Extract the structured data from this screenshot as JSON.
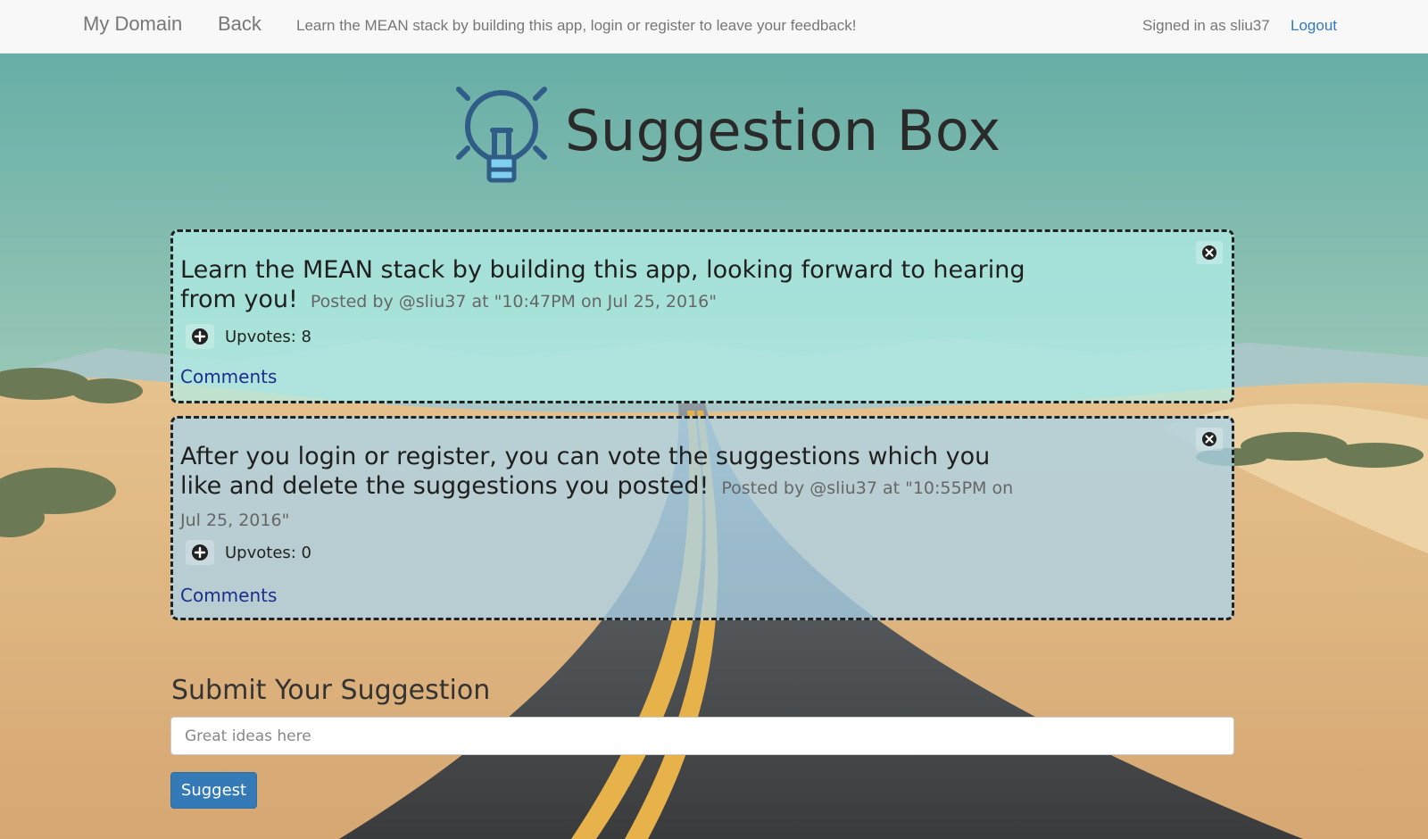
{
  "navbar": {
    "brand": "My Domain",
    "back": "Back",
    "tagline": "Learn the MEAN stack by building this app, login or register to leave your feedback!",
    "signed_in": "Signed in as sliu37",
    "logout": "Logout"
  },
  "header": {
    "title": "Suggestion Box",
    "icon": "lightbulb-icon"
  },
  "suggestions": [
    {
      "text": "Learn the MEAN stack by building this app, looking forward to hearing from you!",
      "posted": "Posted by @sliu37 at \"10:47PM on Jul 25, 2016\"",
      "upvotes": "Upvotes: 8",
      "comments": "Comments"
    },
    {
      "text": "After you login or register, you can vote the suggestions which you like and delete the suggestions you posted!",
      "posted": "Posted by @sliu37 at \"10:55PM on Jul 25, 2016\"",
      "upvotes": "Upvotes: 0",
      "comments": "Comments"
    }
  ],
  "form": {
    "title": "Submit Your Suggestion",
    "placeholder": "Great ideas here",
    "value": "",
    "button": "Suggest"
  },
  "colors": {
    "link": "#337ab7",
    "button": "#337ab7",
    "card_1": "#b2eee8",
    "card_2": "#acd4e8",
    "comments_link": "#1c2e8c"
  }
}
